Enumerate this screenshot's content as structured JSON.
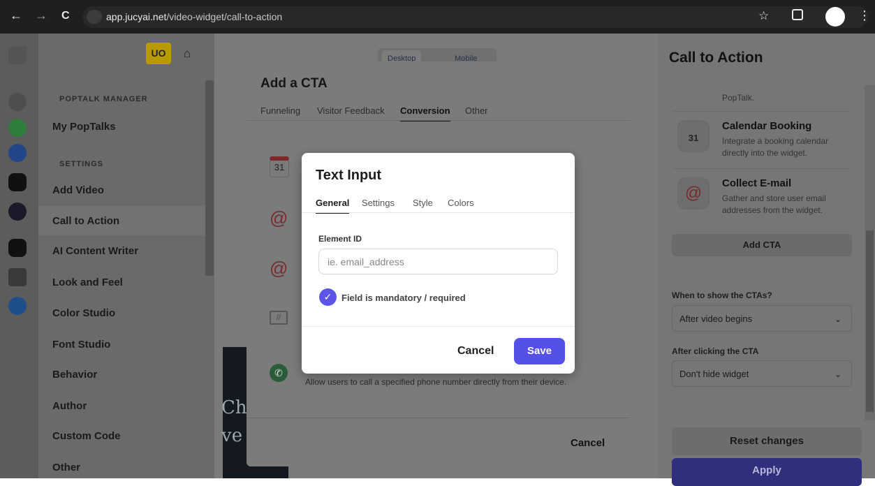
{
  "browser": {
    "url_domain": "app.jucyai.net",
    "url_path": "/video-widget/call-to-action",
    "back_icon": "←",
    "forward_icon": "→",
    "reload_icon": "C"
  },
  "header": {
    "user_initials": "UO",
    "device_toggle": [
      "Desktop",
      "Mobile"
    ]
  },
  "sidebar": {
    "sections": [
      {
        "heading": "POPTALK MANAGER",
        "items": [
          "My PopTalks"
        ]
      },
      {
        "heading": "SETTINGS",
        "items": [
          "Add Video",
          "Call to Action",
          "AI Content Writer",
          "Look and Feel",
          "Color Studio",
          "Font Studio",
          "Behavior",
          "Author",
          "Custom Code",
          "Other"
        ]
      }
    ],
    "active_item": "Call to Action"
  },
  "right_panel": {
    "title": "Call to Action",
    "cards": [
      {
        "title": "",
        "desc": "PopTalk."
      },
      {
        "title": "Calendar Booking",
        "desc": "Integrate a booking calendar directly into the widget.",
        "icon": "calendar-icon",
        "icon_text": "31"
      },
      {
        "title": "Collect E-mail",
        "desc": "Gather and store user email addresses from the widget.",
        "icon": "at-icon",
        "icon_text": "@"
      }
    ],
    "add_cta": "Add CTA",
    "when_label": "When to show the CTAs?",
    "when_value": "After video begins",
    "after_label": "After clicking the CTA",
    "after_value": "Don't hide widget",
    "reset": "Reset changes",
    "apply": "Apply"
  },
  "cta_modal": {
    "title": "Add a CTA",
    "tabs": [
      "Funneling",
      "Visitor Feedback",
      "Conversion",
      "Other"
    ],
    "active_tab": "Conversion",
    "phone_desc": "Allow users to call a specified phone number directly from their device.",
    "cancel": "Cancel"
  },
  "dialog": {
    "title": "Text Input",
    "tabs": [
      "General",
      "Settings",
      "Style",
      "Colors"
    ],
    "active_tab": "General",
    "element_id_label": "Element ID",
    "element_id_value": "",
    "element_id_placeholder": "ie. email_address",
    "mandatory_label": "Field is mandatory / required",
    "mandatory_checked": true,
    "cancel": "Cancel",
    "save": "Save"
  },
  "colors": {
    "accent": "#5450e8",
    "overlay": "#6a6a6a"
  }
}
